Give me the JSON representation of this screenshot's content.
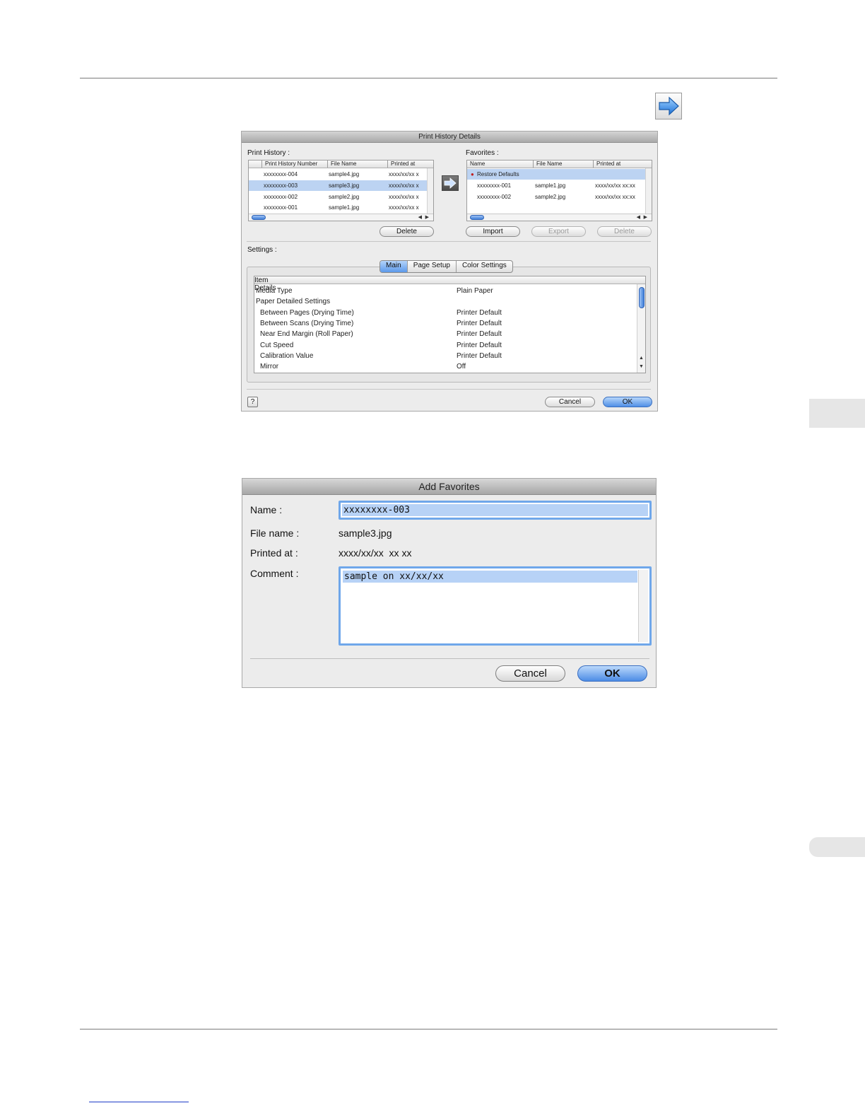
{
  "print_history_dialog": {
    "title": "Print History Details",
    "print_history_label": "Print History :",
    "favorites_label": "Favorites :",
    "history_columns": [
      "Print History Number",
      "File Name",
      "Printed at"
    ],
    "history_rows": [
      {
        "number": "xxxxxxxx-004",
        "file": "sample4.jpg",
        "printed": "xxxx/xx/xx x"
      },
      {
        "number": "xxxxxxxx-003",
        "file": "sample3.jpg",
        "printed": "xxxx/xx/xx x"
      },
      {
        "number": "xxxxxxxx-002",
        "file": "sample2.jpg",
        "printed": "xxxx/xx/xx x"
      },
      {
        "number": "xxxxxxxx-001",
        "file": "sample1.jpg",
        "printed": "xxxx/xx/xx x"
      }
    ],
    "favorites_columns": [
      "Name",
      "File Name",
      "Printed at"
    ],
    "favorites_rows": [
      {
        "name": "Restore Defaults",
        "file": "",
        "printed": ""
      },
      {
        "name": "xxxxxxxx-001",
        "file": "sample1.jpg",
        "printed": "xxxx/xx/xx xx:xx"
      },
      {
        "name": "xxxxxxxx-002",
        "file": "sample2.jpg",
        "printed": "xxxx/xx/xx xx:xx"
      }
    ],
    "delete_history_button": "Delete",
    "import_button": "Import",
    "export_button": "Export",
    "delete_favorite_button": "Delete",
    "settings_label": "Settings :",
    "tabs": [
      "Main",
      "Page Setup",
      "Color Settings"
    ],
    "settings_columns": [
      "Item",
      "Details"
    ],
    "settings_rows": [
      {
        "item": "Media Type",
        "detail": "Plain Paper",
        "indent": 0
      },
      {
        "item": "Paper Detailed Settings",
        "detail": "",
        "indent": 0
      },
      {
        "item": "Between Pages (Drying Time)",
        "detail": "Printer Default",
        "indent": 1
      },
      {
        "item": "Between Scans (Drying Time)",
        "detail": "Printer Default",
        "indent": 1
      },
      {
        "item": "Near End Margin (Roll Paper)",
        "detail": "Printer Default",
        "indent": 1
      },
      {
        "item": "Cut Speed",
        "detail": "Printer Default",
        "indent": 1
      },
      {
        "item": "Calibration Value",
        "detail": "Printer Default",
        "indent": 1
      },
      {
        "item": "Mirror",
        "detail": "Off",
        "indent": 1
      }
    ],
    "help_glyph": "?",
    "cancel_button": "Cancel",
    "ok_button": "OK"
  },
  "add_favorites_dialog": {
    "title": "Add Favorites",
    "name_label": "Name :",
    "name_value": "xxxxxxxx-003",
    "file_name_label": "File name :",
    "file_name_value": "sample3.jpg",
    "printed_at_label": "Printed at :",
    "printed_at_value": "xxxx/xx/xx  xx xx",
    "comment_label": "Comment :",
    "comment_value": "sample on xx/xx/xx",
    "cancel_button": "Cancel",
    "ok_button": "OK"
  },
  "colors": {
    "accent": "#4f8fe6",
    "selection": "#bcd3f2"
  }
}
